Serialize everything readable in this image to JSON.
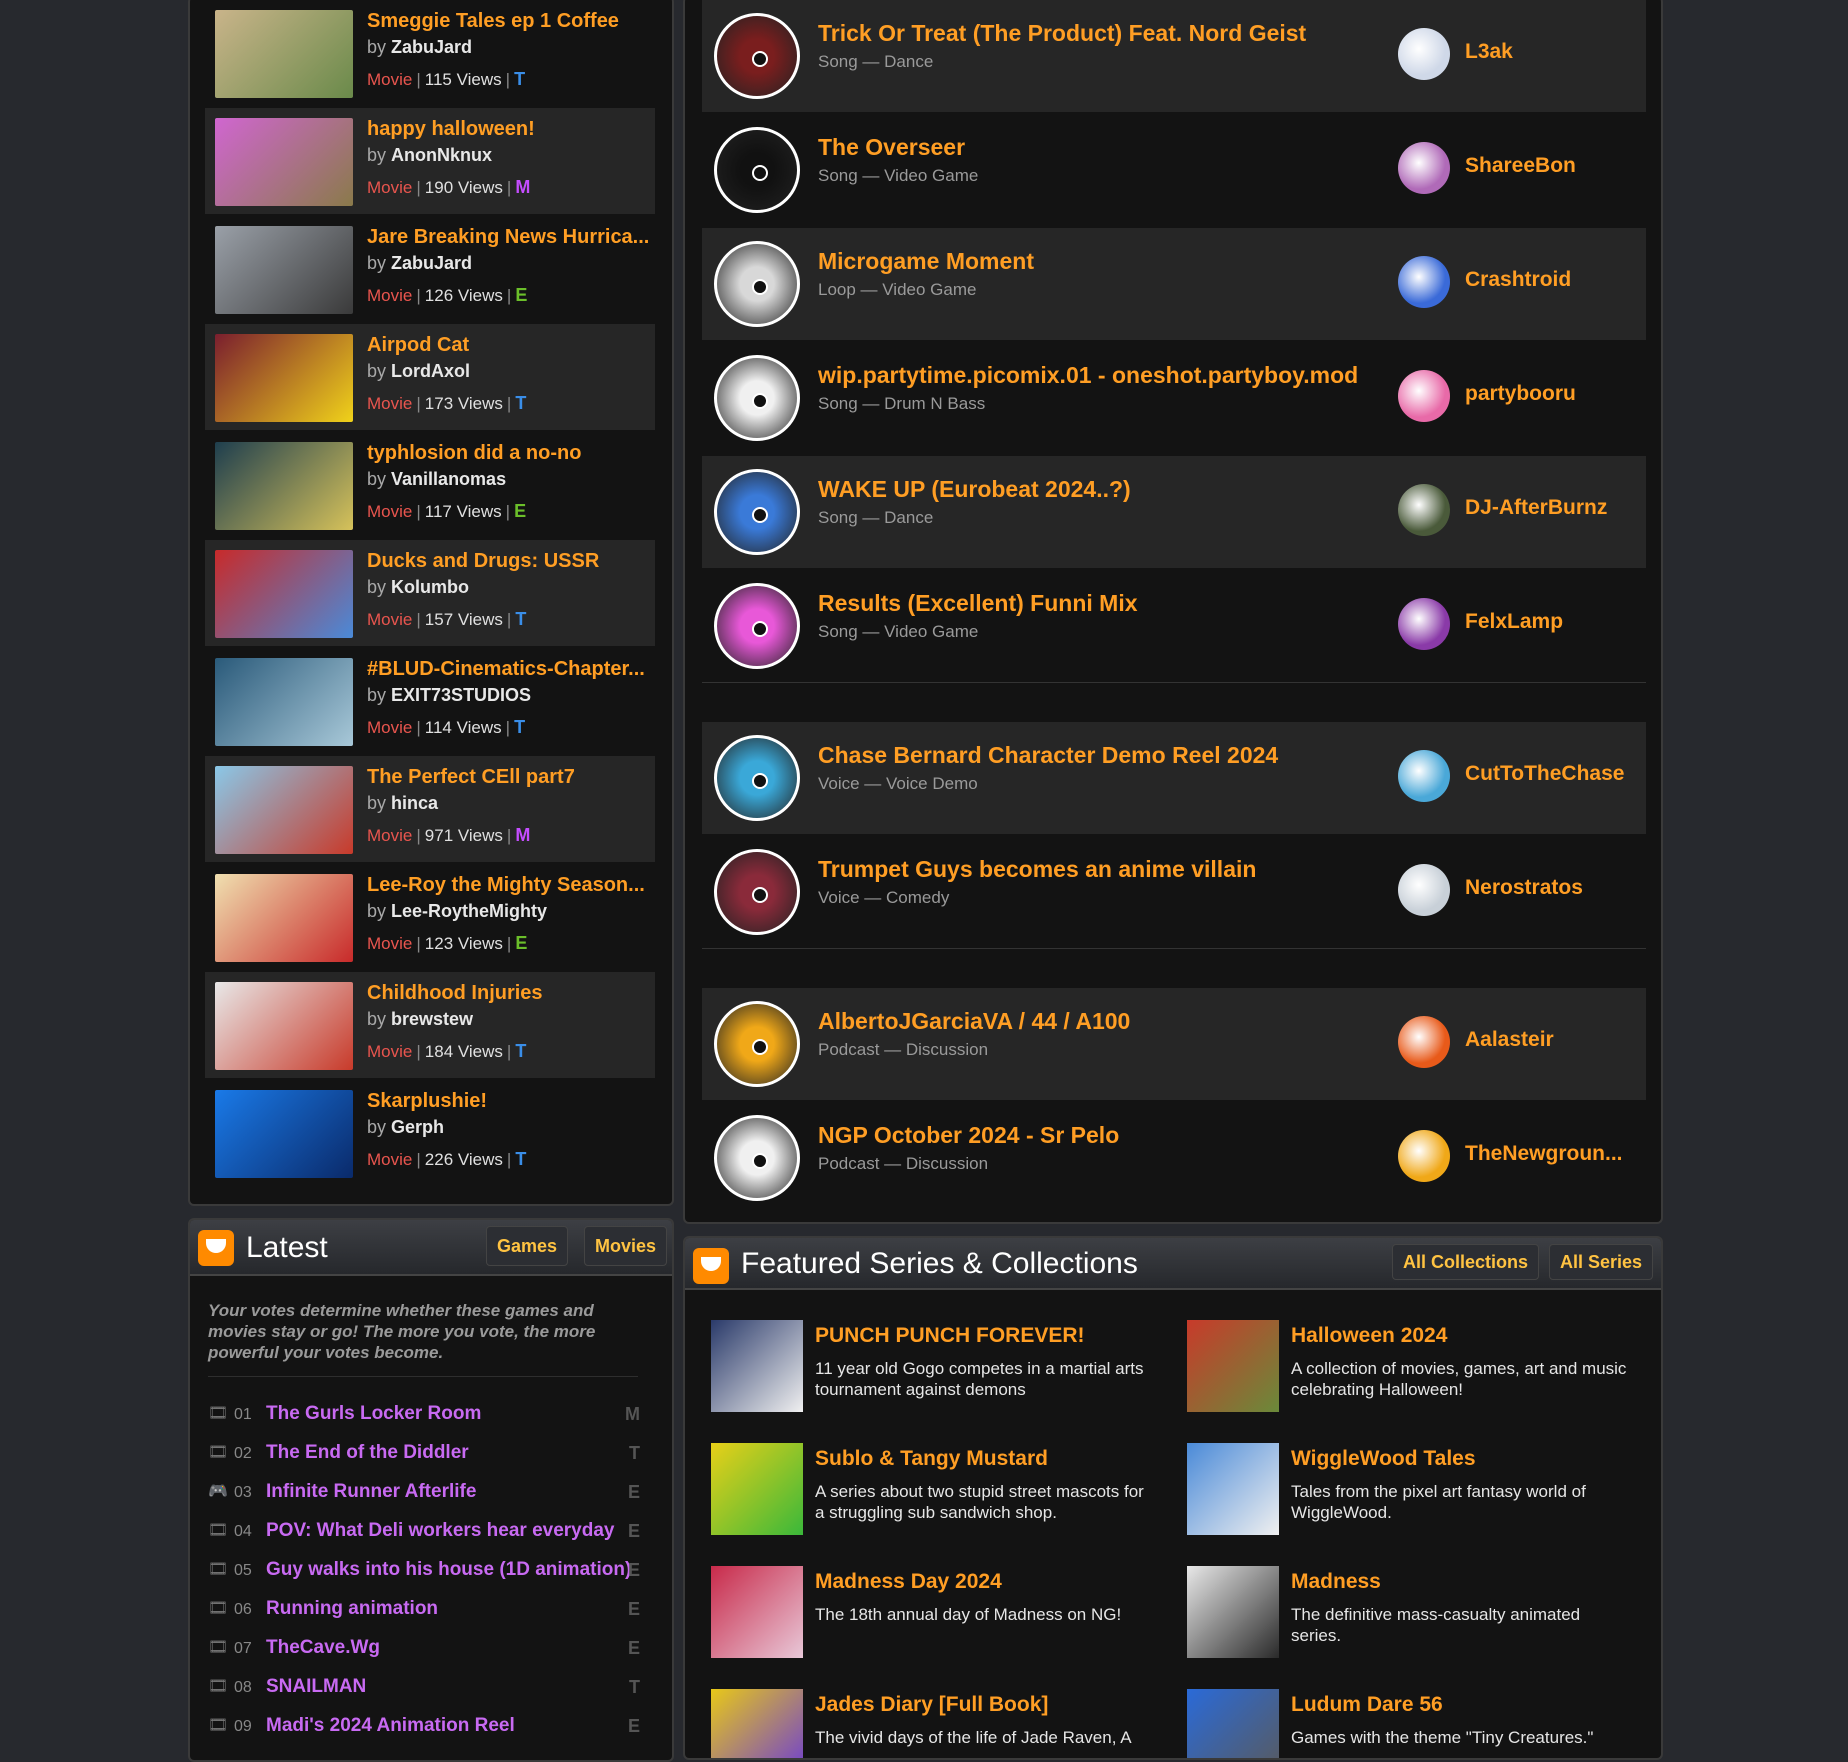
{
  "movies": [
    {
      "title": "Smeggie Tales ep 1 Coffee",
      "by": "by",
      "author": "ZabuJard",
      "type": "Movie",
      "views": "115 Views",
      "rating": "T",
      "thumb_colors": [
        "#c9b48a",
        "#6a8a4a"
      ]
    },
    {
      "title": "happy halloween!",
      "by": "by",
      "author": "AnonNknux",
      "type": "Movie",
      "views": "190 Views",
      "rating": "M",
      "thumb_colors": [
        "#d066d0",
        "#8a7a4a"
      ]
    },
    {
      "title": "Jare Breaking News Hurrica...",
      "by": "by",
      "author": "ZabuJard",
      "type": "Movie",
      "views": "126 Views",
      "rating": "E",
      "thumb_colors": [
        "#9aa0a8",
        "#3a3a3a"
      ]
    },
    {
      "title": "Airpod Cat",
      "by": "by",
      "author": "LordAxol",
      "type": "Movie",
      "views": "173 Views",
      "rating": "T",
      "thumb_colors": [
        "#7a1e2e",
        "#f0d21a"
      ]
    },
    {
      "title": "typhlosion did a no-no",
      "by": "by",
      "author": "Vanillanomas",
      "type": "Movie",
      "views": "117 Views",
      "rating": "E",
      "thumb_colors": [
        "#1e3e4e",
        "#d6c25a"
      ]
    },
    {
      "title": "Ducks and Drugs: USSR",
      "by": "by",
      "author": "Kolumbo",
      "type": "Movie",
      "views": "157 Views",
      "rating": "T",
      "thumb_colors": [
        "#c82a2a",
        "#4a8ad8"
      ]
    },
    {
      "title": "#BLUD-Cinematics-Chapter...",
      "by": "by",
      "author": "EXIT73STUDIOS",
      "type": "Movie",
      "views": "114 Views",
      "rating": "T",
      "thumb_colors": [
        "#2a5a7a",
        "#a8c8d8"
      ]
    },
    {
      "title": "The Perfect CEll part7",
      "by": "by",
      "author": "hinca",
      "type": "Movie",
      "views": "971 Views",
      "rating": "M",
      "thumb_colors": [
        "#8ac8e8",
        "#c83a2a"
      ]
    },
    {
      "title": "Lee-Roy the Mighty Season...",
      "by": "by",
      "author": "Lee-RoytheMighty",
      "type": "Movie",
      "views": "123 Views",
      "rating": "E",
      "thumb_colors": [
        "#f0e0b0",
        "#c82a2a"
      ]
    },
    {
      "title": "Childhood Injuries",
      "by": "by",
      "author": "brewstew",
      "type": "Movie",
      "views": "184 Views",
      "rating": "T",
      "thumb_colors": [
        "#e8e8e8",
        "#c83a2a"
      ]
    },
    {
      "title": "Skarplushie!",
      "by": "by",
      "author": "Gerph",
      "type": "Movie",
      "views": "226 Views",
      "rating": "T",
      "thumb_colors": [
        "#1a7ae8",
        "#0a2a6a"
      ]
    }
  ],
  "audio": [
    {
      "title": "Trick Or Treat (The Product) Feat. Nord Geist",
      "sub": "Song — Dance",
      "artist": "L3ak",
      "disc_color": "#7a1e1e",
      "avatar_color": "#cfd8e8"
    },
    {
      "title": "The Overseer",
      "sub": "Song — Video Game",
      "artist": "ShareeBon",
      "disc_color": "#111111",
      "avatar_color": "#b06ab8"
    },
    {
      "title": "Microgame Moment",
      "sub": "Loop — Video Game",
      "artist": "Crashtroid",
      "disc_color": "#d8d8d8",
      "avatar_color": "#3a6ad8"
    },
    {
      "title": "wip.partytime.picomix.01 - oneshot.partyboy.mod",
      "sub": "Song — Drum N Bass",
      "artist": "partybooru",
      "disc_color": "#f0f0f0",
      "avatar_color": "#e86aa8"
    },
    {
      "title": "WAKE UP (Eurobeat 2024..?)",
      "sub": "Song — Dance",
      "artist": "DJ-AfterBurnz",
      "disc_color": "#3a7ad8",
      "avatar_color": "#4a5a3a"
    },
    {
      "title": "Results (Excellent) Funni Mix",
      "sub": "Song — Video Game",
      "artist": "FelxLamp",
      "disc_color": "#e858d8",
      "avatar_color": "#8a3aa8"
    },
    {
      "title": "Chase Bernard Character Demo Reel 2024",
      "sub": "Voice — Voice Demo",
      "artist": "CutToTheChase",
      "disc_color": "#3aa8d8",
      "avatar_color": "#4aa8d8"
    },
    {
      "title": "Trumpet Guys becomes an anime villain",
      "sub": "Voice — Comedy",
      "artist": "Nerostratos",
      "disc_color": "#8a2a3a",
      "avatar_color": "#c8d0d8"
    },
    {
      "title": "AlbertoJGarciaVA / 44 / A100",
      "sub": "Podcast — Discussion",
      "artist": "Aalasteir",
      "disc_color": "#f0a818",
      "avatar_color": "#e85a1a"
    },
    {
      "title": "NGP October 2024 - Sr Pelo",
      "sub": "Podcast — Discussion",
      "artist": "TheNewgroun...",
      "disc_color": "#f0f0f0",
      "avatar_color": "#f0a818"
    }
  ],
  "latest": {
    "title": "Latest",
    "tabs": [
      "Games",
      "Movies"
    ],
    "note": "Your votes determine whether these games and movies stay or go! The more you vote, the more powerful your votes become.",
    "items": [
      {
        "num": "01",
        "title": "The Gurls Locker Room",
        "rating": "M",
        "icon": "film-icon"
      },
      {
        "num": "02",
        "title": "The End of the Diddler",
        "rating": "T",
        "icon": "film-icon"
      },
      {
        "num": "03",
        "title": "Infinite Runner Afterlife",
        "rating": "E",
        "icon": "gamepad-icon"
      },
      {
        "num": "04",
        "title": "POV: What Deli workers hear everyday",
        "rating": "E",
        "icon": "film-icon"
      },
      {
        "num": "05",
        "title": "Guy walks into his house (1D animation)",
        "rating": "E",
        "icon": "film-icon"
      },
      {
        "num": "06",
        "title": "Running animation",
        "rating": "E",
        "icon": "film-icon"
      },
      {
        "num": "07",
        "title": "TheCave.Wg",
        "rating": "E",
        "icon": "film-icon"
      },
      {
        "num": "08",
        "title": "SNAILMAN",
        "rating": "T",
        "icon": "film-icon"
      },
      {
        "num": "09",
        "title": "Madi's 2024 Animation Reel",
        "rating": "E",
        "icon": "film-icon"
      }
    ]
  },
  "featured": {
    "title": "Featured Series & Collections",
    "buttons": [
      "All Collections",
      "All Series"
    ],
    "items": [
      {
        "title": "PUNCH PUNCH FOREVER!",
        "desc": "11 year old Gogo competes in a martial arts tournament against demons",
        "thumb_colors": [
          "#2a3a6a",
          "#f0f0f0"
        ]
      },
      {
        "title": "Halloween 2024",
        "desc": "A collection of movies, games, art and music celebrating Halloween!",
        "thumb_colors": [
          "#c83a2a",
          "#6a8a3a"
        ]
      },
      {
        "title": "Sublo & Tangy Mustard",
        "desc": "A series about two stupid street mascots for a struggling sub sandwich shop.",
        "thumb_colors": [
          "#e8d018",
          "#3ab83a"
        ]
      },
      {
        "title": "WiggleWood Tales",
        "desc": "Tales from the pixel art fantasy world of WiggleWood.",
        "thumb_colors": [
          "#4a8ad8",
          "#f0f0f0"
        ]
      },
      {
        "title": "Madness Day 2024",
        "desc": "The 18th annual day of Madness on NG!",
        "thumb_colors": [
          "#c82a4a",
          "#e8c8d8"
        ]
      },
      {
        "title": "Madness",
        "desc": "The definitive mass-casualty animated series.",
        "thumb_colors": [
          "#e8e8e8",
          "#2a2a2a"
        ]
      },
      {
        "title": "Jades Diary [Full Book]",
        "desc": "The vivid days of the life of Jade Raven, A",
        "thumb_colors": [
          "#e8c818",
          "#6a3ad8"
        ]
      },
      {
        "title": "Ludum Dare 56",
        "desc": "Games with the theme \"Tiny Creatures.\"",
        "thumb_colors": [
          "#2a6ad8",
          "#5a5a5a"
        ]
      }
    ]
  },
  "colors": {
    "accent": "#ff9e24",
    "purple": "#c86af2",
    "panel": "#131313",
    "alt_row": "#262626"
  }
}
